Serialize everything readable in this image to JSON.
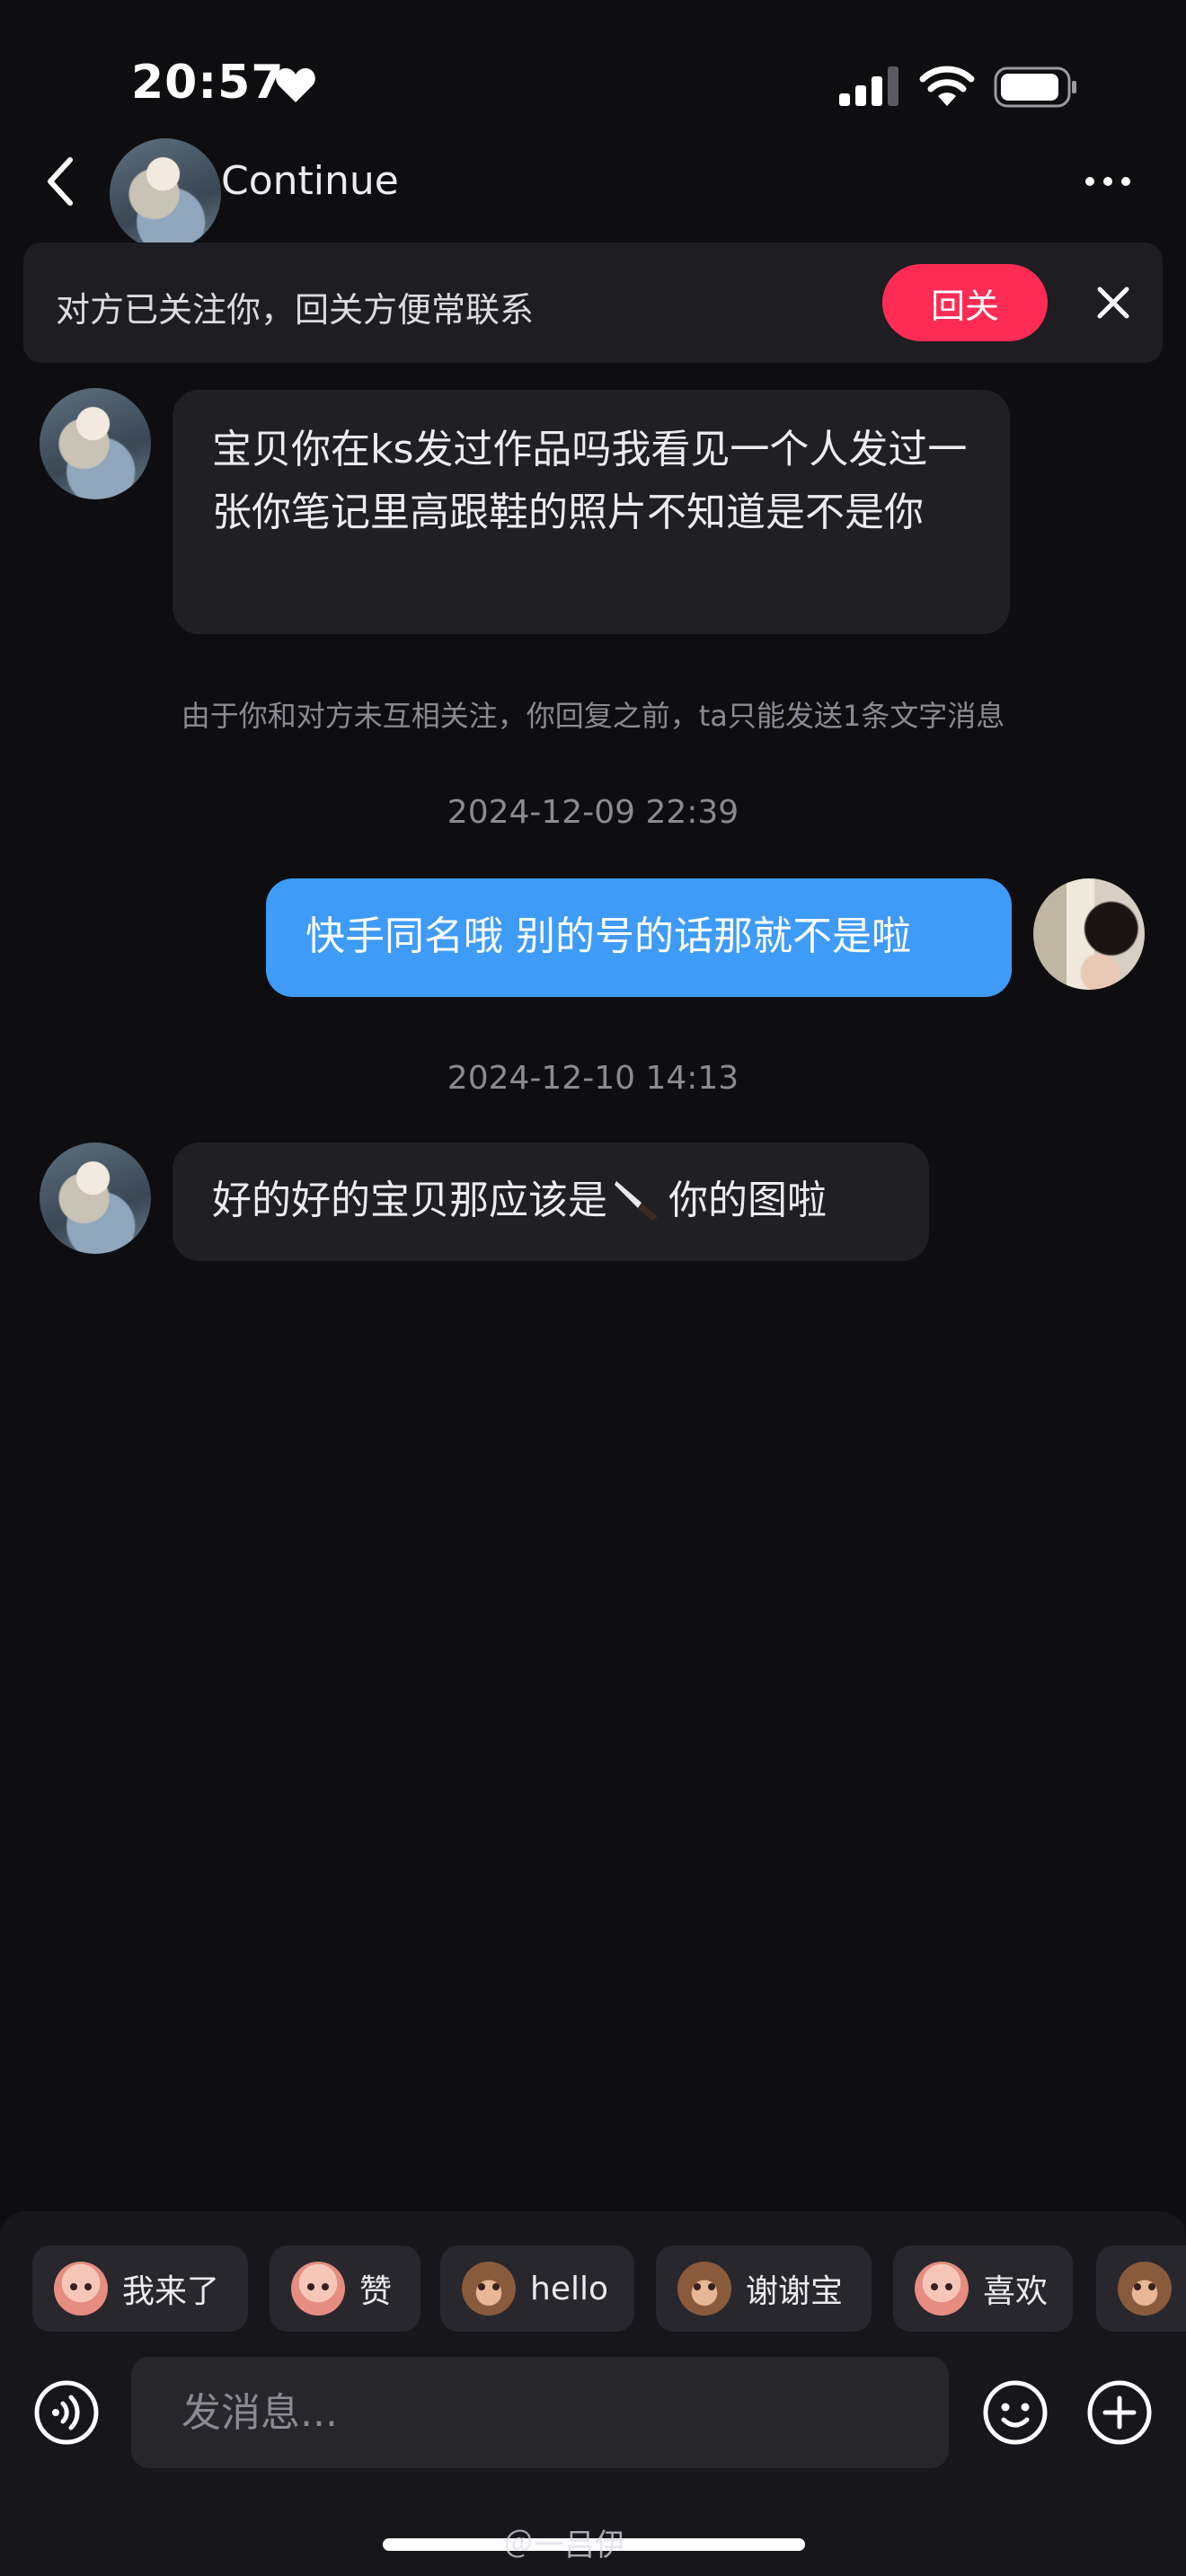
{
  "status_bar": {
    "time": "20:57"
  },
  "header": {
    "contact_name": "Continue"
  },
  "banner": {
    "text": "对方已关注你，回关方便常联系",
    "button_label": "回关"
  },
  "messages": [
    {
      "from": "them",
      "text": "宝贝你在ks发过作品吗我看见一个人发过一张你笔记里高跟鞋的照片不知道是不是你"
    },
    {
      "from": "me",
      "text": "快手同名哦 别的号的话那就不是啦",
      "timestamp": "2024-12-09 22:39"
    },
    {
      "from": "them",
      "text_before": "好的好的宝贝那应该是",
      "text_after": "你的图啦",
      "timestamp": "2024-12-10 14:13"
    }
  ],
  "notice": "由于你和对方未互相关注，你回复之前，ta只能发送1条文字消息",
  "quick_replies": [
    "我来了",
    "赞",
    "hello",
    "谢谢宝",
    "喜欢"
  ],
  "composer": {
    "placeholder": "发消息..."
  },
  "watermark": "＠一吕伊",
  "colors": {
    "accent": "#fe2c55",
    "outgoing_bubble": "#3f9bf8",
    "background": "#0e0e11"
  }
}
